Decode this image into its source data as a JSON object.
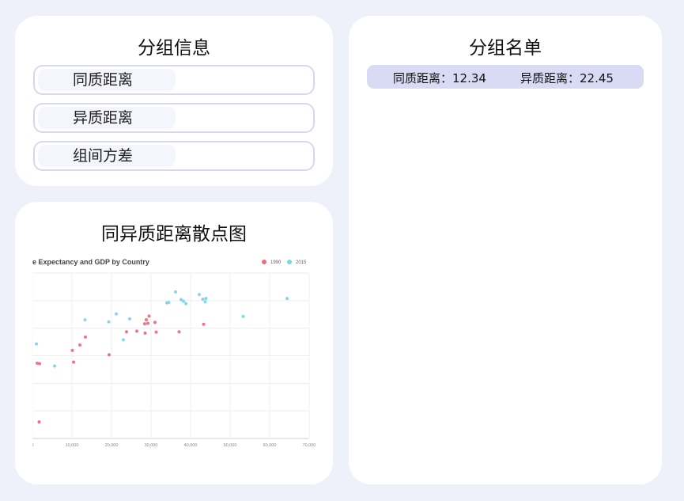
{
  "group_info": {
    "title": "分组信息",
    "options": [
      {
        "label": "同质距离"
      },
      {
        "label": "异质距离"
      },
      {
        "label": "组间方差"
      }
    ]
  },
  "scatter_panel": {
    "title": "同异质距离散点图"
  },
  "group_list": {
    "title": "分组名单",
    "row": {
      "homo_label": "同质距离：",
      "homo_value": "12.34",
      "hetero_label": "异质距离：",
      "hetero_value": "22.45"
    }
  },
  "chart_data": {
    "type": "scatter",
    "title": "e Expectancy and GDP by Country",
    "xlim": [
      0,
      70000
    ],
    "ylim": [
      0,
      100
    ],
    "x_ticks": [
      {
        "value": 0,
        "label": "0"
      },
      {
        "value": 10000,
        "label": "10,000"
      },
      {
        "value": 20000,
        "label": "20,000"
      },
      {
        "value": 30000,
        "label": "30,000"
      },
      {
        "value": 40000,
        "label": "40,000"
      },
      {
        "value": 50000,
        "label": "50,000"
      },
      {
        "value": 60000,
        "label": "60,000"
      },
      {
        "value": 70000,
        "label": "70,000"
      }
    ],
    "grid": true,
    "legend_placement": "top-right",
    "series": [
      {
        "name": "1990",
        "color": "#ee6c7e",
        "points": [
          [
            1200,
            45.5
          ],
          [
            1800,
            45.2
          ],
          [
            1700,
            10.0
          ],
          [
            10100,
            53.2
          ],
          [
            10400,
            46.2
          ],
          [
            12000,
            56.5
          ],
          [
            13400,
            61.3
          ],
          [
            19400,
            50.6
          ],
          [
            23800,
            64.5
          ],
          [
            26400,
            64.9
          ],
          [
            28400,
            69.3
          ],
          [
            28500,
            63.7
          ],
          [
            28800,
            71.8
          ],
          [
            29200,
            69.6
          ],
          [
            29500,
            74.0
          ],
          [
            31000,
            70.2
          ],
          [
            31300,
            64.3
          ],
          [
            37100,
            64.5
          ],
          [
            43300,
            69.0
          ]
        ]
      },
      {
        "name": "2015",
        "color": "#7fd4ea",
        "points": [
          [
            1000,
            57.2
          ],
          [
            5600,
            43.8
          ],
          [
            13300,
            71.7
          ],
          [
            19300,
            70.5
          ],
          [
            21200,
            75.3
          ],
          [
            23000,
            59.6
          ],
          [
            24600,
            72.3
          ],
          [
            34000,
            82.0
          ],
          [
            34500,
            82.2
          ],
          [
            36200,
            88.6
          ],
          [
            37600,
            84.0
          ],
          [
            38200,
            83.0
          ],
          [
            38800,
            81.5
          ],
          [
            42200,
            87.0
          ],
          [
            43100,
            84.2
          ],
          [
            43700,
            82.6
          ],
          [
            43900,
            84.6
          ],
          [
            53300,
            73.8
          ],
          [
            64400,
            84.6
          ]
        ]
      }
    ]
  }
}
